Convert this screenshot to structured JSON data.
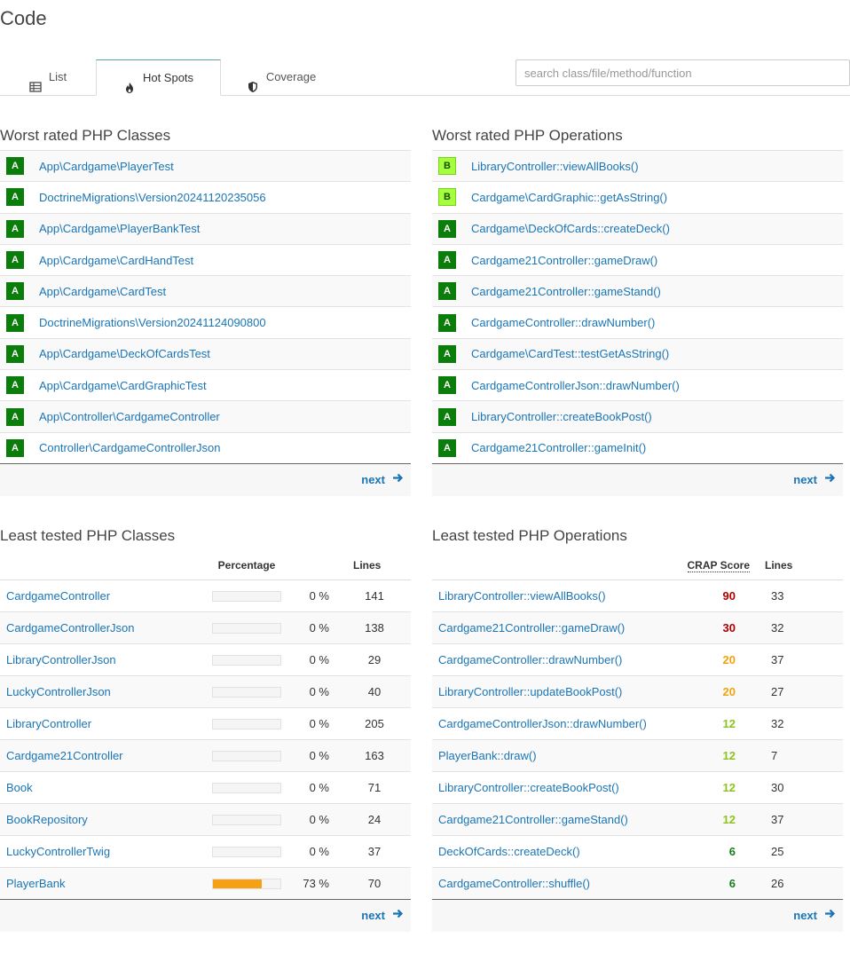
{
  "page": {
    "title": "Code"
  },
  "tabs": [
    {
      "label": "List",
      "icon": "table-icon"
    },
    {
      "label": "Hot Spots",
      "icon": "fire-icon"
    },
    {
      "label": "Coverage",
      "icon": "shield-icon"
    }
  ],
  "search": {
    "placeholder": "search class/file/method/function",
    "value": ""
  },
  "worst_classes": {
    "title": "Worst rated PHP Classes",
    "rows": [
      {
        "grade": "A",
        "name": "App\\Cardgame\\PlayerTest"
      },
      {
        "grade": "A",
        "name": "DoctrineMigrations\\Version20241120235056"
      },
      {
        "grade": "A",
        "name": "App\\Cardgame\\PlayerBankTest"
      },
      {
        "grade": "A",
        "name": "App\\Cardgame\\CardHandTest"
      },
      {
        "grade": "A",
        "name": "App\\Cardgame\\CardTest"
      },
      {
        "grade": "A",
        "name": "DoctrineMigrations\\Version20241124090800"
      },
      {
        "grade": "A",
        "name": "App\\Cardgame\\DeckOfCardsTest"
      },
      {
        "grade": "A",
        "name": "App\\Cardgame\\CardGraphicTest"
      },
      {
        "grade": "A",
        "name": "App\\Controller\\CardgameController"
      },
      {
        "grade": "A",
        "name": "Controller\\CardgameControllerJson"
      }
    ],
    "next_label": "next"
  },
  "worst_operations": {
    "title": "Worst rated PHP Operations",
    "rows": [
      {
        "grade": "B",
        "name": "LibraryController::viewAllBooks()"
      },
      {
        "grade": "B",
        "name": "Cardgame\\CardGraphic::getAsString()"
      },
      {
        "grade": "A",
        "name": "Cardgame\\DeckOfCards::createDeck()"
      },
      {
        "grade": "A",
        "name": "Cardgame21Controller::gameDraw()"
      },
      {
        "grade": "A",
        "name": "Cardgame21Controller::gameStand()"
      },
      {
        "grade": "A",
        "name": "CardgameController::drawNumber()"
      },
      {
        "grade": "A",
        "name": "Cardgame\\CardTest::testGetAsString()"
      },
      {
        "grade": "A",
        "name": "CardgameControllerJson::drawNumber()"
      },
      {
        "grade": "A",
        "name": "LibraryController::createBookPost()"
      },
      {
        "grade": "A",
        "name": "Cardgame21Controller::gameInit()"
      }
    ],
    "next_label": "next"
  },
  "least_classes": {
    "title": "Least tested PHP Classes",
    "headers": {
      "percentage": "Percentage",
      "lines": "Lines"
    },
    "rows": [
      {
        "name": "CardgameController",
        "percent": 0,
        "percent_label": "0 %",
        "lines": "141"
      },
      {
        "name": "CardgameControllerJson",
        "percent": 0,
        "percent_label": "0 %",
        "lines": "138"
      },
      {
        "name": "LibraryControllerJson",
        "percent": 0,
        "percent_label": "0 %",
        "lines": "29"
      },
      {
        "name": "LuckyControllerJson",
        "percent": 0,
        "percent_label": "0 %",
        "lines": "40"
      },
      {
        "name": "LibraryController",
        "percent": 0,
        "percent_label": "0 %",
        "lines": "205"
      },
      {
        "name": "Cardgame21Controller",
        "percent": 0,
        "percent_label": "0 %",
        "lines": "163"
      },
      {
        "name": "Book",
        "percent": 0,
        "percent_label": "0 %",
        "lines": "71"
      },
      {
        "name": "BookRepository",
        "percent": 0,
        "percent_label": "0 %",
        "lines": "24"
      },
      {
        "name": "LuckyControllerTwig",
        "percent": 0,
        "percent_label": "0 %",
        "lines": "37"
      },
      {
        "name": "PlayerBank",
        "percent": 73,
        "percent_label": "73 %",
        "lines": "70"
      }
    ],
    "next_label": "next"
  },
  "least_operations": {
    "title": "Least tested PHP Operations",
    "headers": {
      "crap": "CRAP Score",
      "lines": "Lines"
    },
    "rows": [
      {
        "name": "LibraryController::viewAllBooks()",
        "crap": "90",
        "color": "#b10000",
        "lines": "33"
      },
      {
        "name": "Cardgame21Controller::gameDraw()",
        "crap": "30",
        "color": "#b10000",
        "lines": "32"
      },
      {
        "name": "CardgameController::drawNumber()",
        "crap": "20",
        "color": "#f0a30a",
        "lines": "37"
      },
      {
        "name": "LibraryController::updateBookPost()",
        "crap": "20",
        "color": "#f0a30a",
        "lines": "27"
      },
      {
        "name": "CardgameControllerJson::drawNumber()",
        "crap": "12",
        "color": "#8cc31e",
        "lines": "32"
      },
      {
        "name": "PlayerBank::draw()",
        "crap": "12",
        "color": "#8cc31e",
        "lines": "7"
      },
      {
        "name": "LibraryController::createBookPost()",
        "crap": "12",
        "color": "#8cc31e",
        "lines": "30"
      },
      {
        "name": "Cardgame21Controller::gameStand()",
        "crap": "12",
        "color": "#8cc31e",
        "lines": "37"
      },
      {
        "name": "DeckOfCards::createDeck()",
        "crap": "6",
        "color": "#1a7d1a",
        "lines": "25"
      },
      {
        "name": "CardgameController::shuffle()",
        "crap": "6",
        "color": "#1a7d1a",
        "lines": "26"
      }
    ],
    "next_label": "next"
  },
  "colors": {
    "link": "#1a75b5",
    "grade_a": "#0a7d0a",
    "grade_b": "#a6ff3c",
    "coverage_bar": "#f5a113"
  }
}
